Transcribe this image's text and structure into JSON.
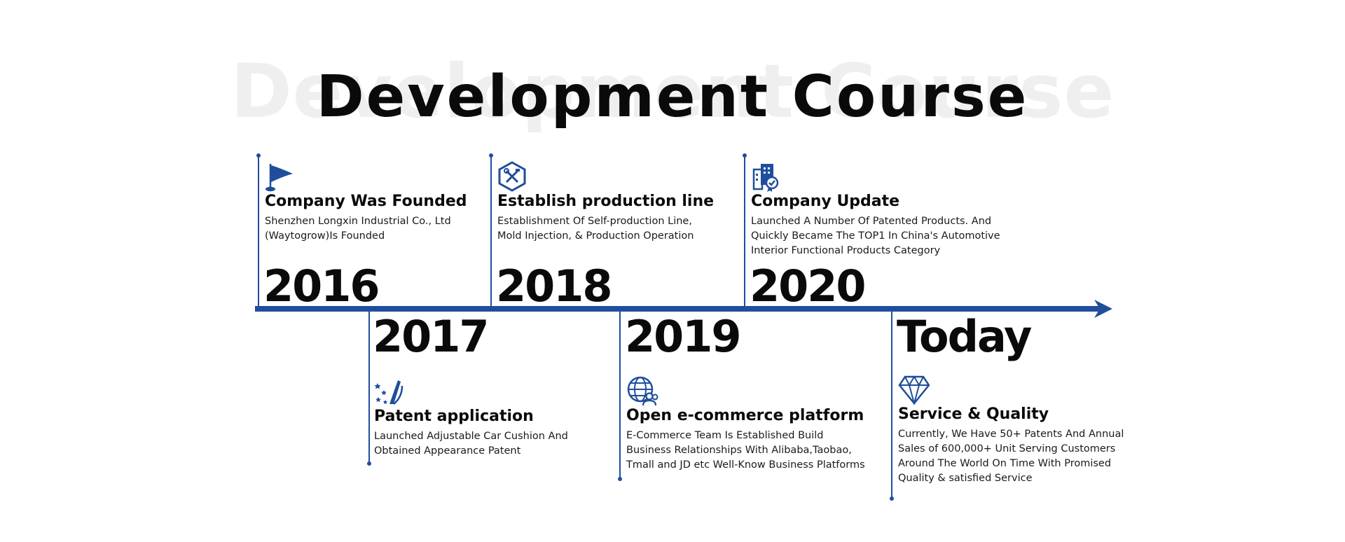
{
  "header": {
    "title": "Development Course",
    "watermark": "Development Course"
  },
  "colors": {
    "accent": "#1f4e9c",
    "text": "#0a0a0a",
    "watermark": "#efefef"
  },
  "milestones": [
    {
      "year": "2016",
      "icon": "flag-icon",
      "title": "Company Was Founded",
      "desc": "Shenzhen Longxin Industrial Co., Ltd\n(Waytogrow)Is Founded"
    },
    {
      "year": "2017",
      "icon": "patent-icon",
      "title": "Patent application",
      "desc": "Launched Adjustable Car Cushion And\nObtained Appearance Patent"
    },
    {
      "year": "2018",
      "icon": "tools-icon",
      "title": "Establish production line",
      "desc": "Establishment Of Self-production Line,\nMold Injection, & Production Operation"
    },
    {
      "year": "2019",
      "icon": "globe-users-icon",
      "title": "Open e-commerce platform",
      "desc": "E-Commerce Team Is Established Build\nBusiness Relationships With Alibaba,Taobao,\nTmall and JD etc Well-Know Business Platforms"
    },
    {
      "year": "2020",
      "icon": "certified-building-icon",
      "title": "Company Update",
      "desc": "Launched A Number Of Patented Products. And\nQuickly Became The TOP1 In China's Automotive\nInterior Functional Products Category"
    },
    {
      "year": "Today",
      "icon": "diamond-icon",
      "title": "Service & Quality",
      "desc": "Currently, We Have 50+ Patents And Annual\nSales of 600,000+ Unit Serving Customers\nAround The World On Time With Promised\nQuality & satisfied Service"
    }
  ]
}
